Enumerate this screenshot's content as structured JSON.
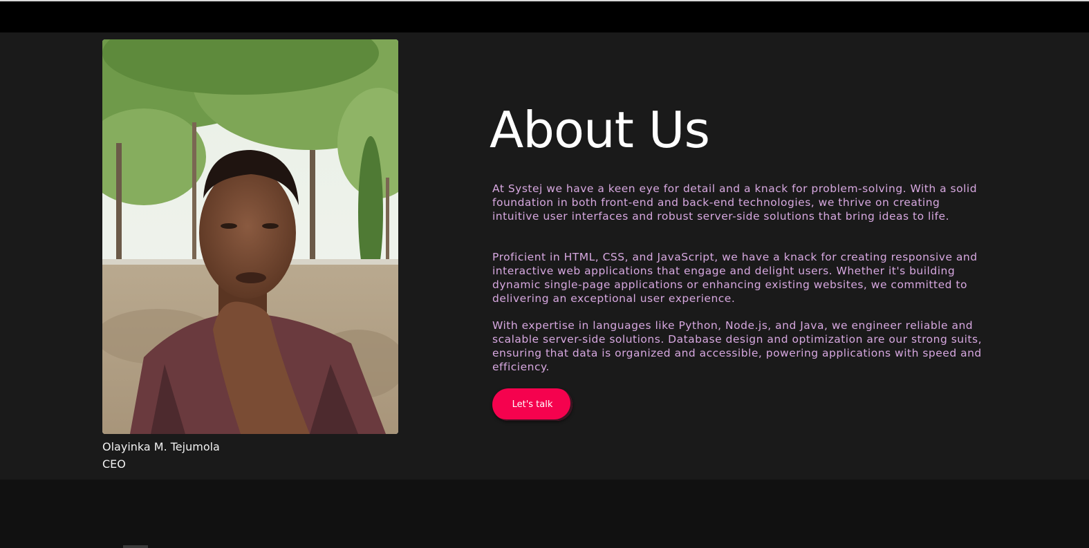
{
  "about": {
    "title": "About Us",
    "paragraphs": [
      "At Systej we have a keen eye for detail and a knack for problem-solving. With a solid foundation in both front-end and back-end technologies, we thrive on creating intuitive user interfaces and robust server-side solutions that bring ideas to life.",
      "Proficient in HTML, CSS, and JavaScript, we have a knack for creating responsive and interactive web applications that engage and delight users. Whether it's building dynamic single-page applications or enhancing existing websites, we committed to delivering an exceptional user experience.",
      "With expertise in languages like Python, Node.js, and Java, we engineer reliable and scalable server-side solutions. Database design and optimization are our strong suits, ensuring that data is organized and accessible, powering applications with speed and efficiency."
    ],
    "cta_label": "Let's talk"
  },
  "team_member": {
    "name": "Olayinka M. Tejumola",
    "role": "CEO"
  },
  "colors": {
    "section_bg": "#1a1a1a",
    "text_accent": "#d7a8e0",
    "button": "#f5024e"
  }
}
